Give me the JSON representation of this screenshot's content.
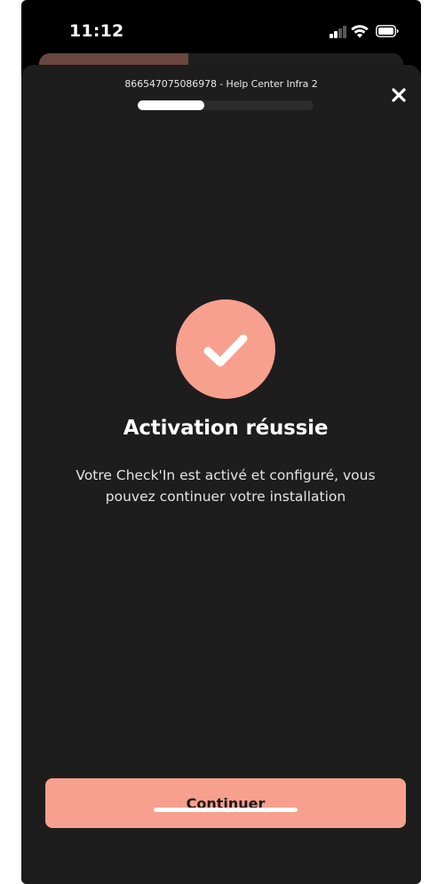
{
  "status_bar": {
    "time": "11:12",
    "signal_icon": "cellular-signal-icon",
    "wifi_icon": "wifi-icon",
    "battery_icon": "battery-icon"
  },
  "sheet": {
    "title": "866547075086978 - Help Center Infra 2",
    "close_icon": "close-icon",
    "progress_fraction": 0.38
  },
  "success": {
    "icon": "checkmark-icon",
    "headline": "Activation réussie",
    "message": "Votre Check'In est activé et configuré, vous pouvez continuer votre installation"
  },
  "actions": {
    "continue_label": "Continuer"
  },
  "colors": {
    "accent": "#f7a08d",
    "sheet_background": "#1d1d1d",
    "background": "#000000"
  }
}
